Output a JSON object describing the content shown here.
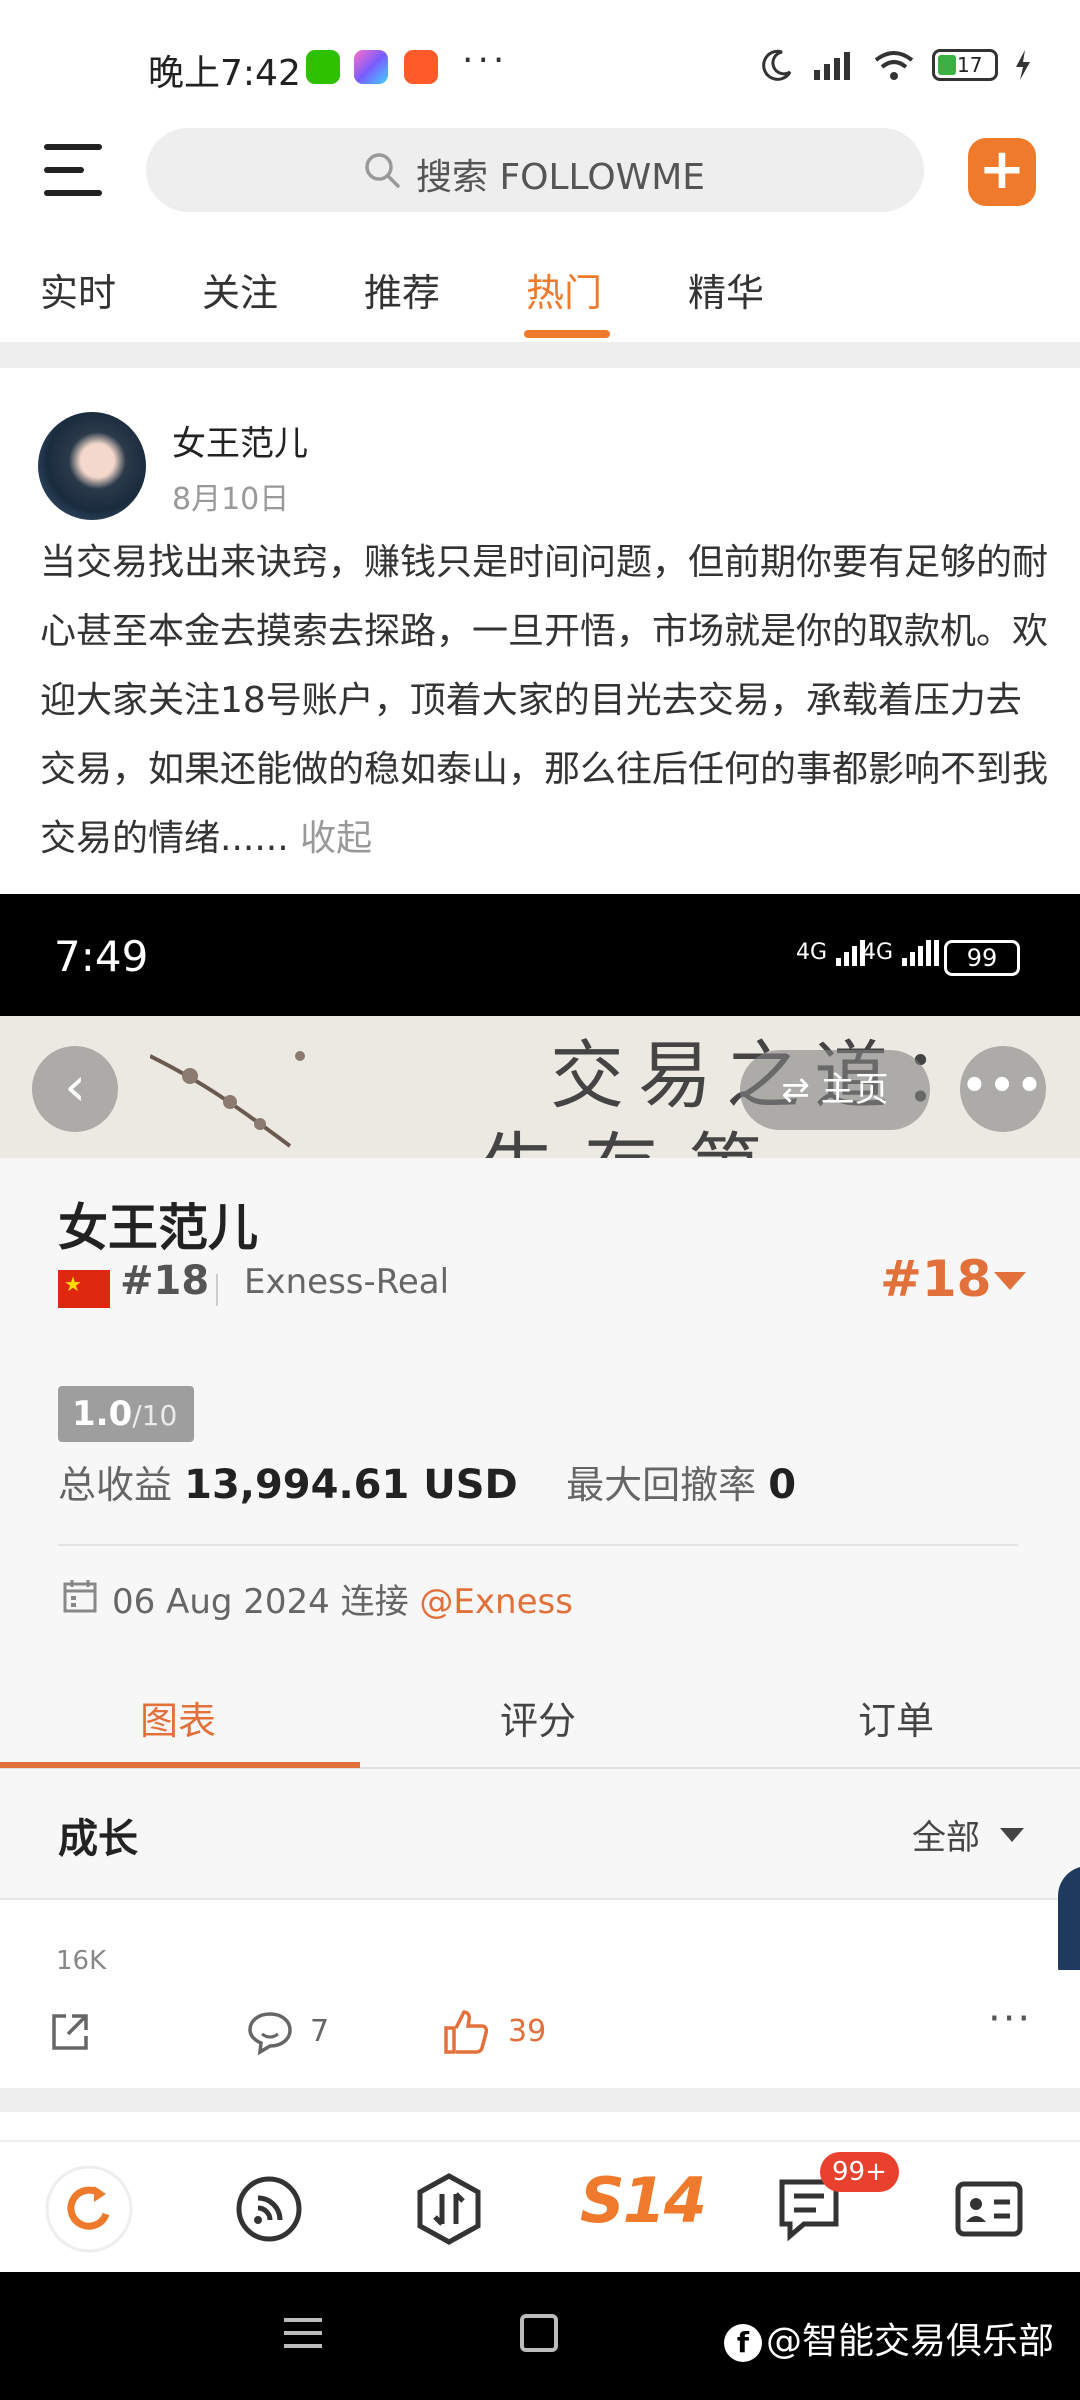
{
  "status_bar": {
    "time": "晚上7:42",
    "dots": "···",
    "battery": "17"
  },
  "header": {
    "search_placeholder": "搜索 FOLLOWME"
  },
  "tabs": [
    {
      "label": "实时"
    },
    {
      "label": "关注"
    },
    {
      "label": "推荐"
    },
    {
      "label": "热门"
    },
    {
      "label": "精华"
    }
  ],
  "active_tab": "热门",
  "post": {
    "author": "女王范儿",
    "date": "8月10日",
    "body": "当交易找出来诀窍，赚钱只是时间问题，但前期你要有足够的耐心甚至本金去摸索去探路，一旦开悟，市场就是你的取款机。欢迎大家关注18号账户，顶着大家的目光去交易，承载着压力去交易，如果还能做的稳如泰山，那么往后任何的事都影响不到我交易的情绪......",
    "collapse_label": "收起"
  },
  "inner": {
    "status": {
      "time": "7:49",
      "signal1": "4G",
      "signal2": "4G",
      "battery": "99"
    },
    "banner": {
      "line1": "交易之道：",
      "line2": "生存第一",
      "home_label": "主页"
    },
    "account": {
      "name": "女王范儿",
      "rank": "#18",
      "server": "Exness-Real",
      "rank_big": "#18",
      "score": "1.0",
      "score_max": "/10",
      "profit_label": "总收益",
      "profit_value": "13,994.61 USD",
      "drawdown_label": "最大回撤率",
      "drawdown_value": "0",
      "connect_date": "06 Aug 2024 连接",
      "connect_broker": "@Exness"
    },
    "tabs": [
      {
        "label": "图表"
      },
      {
        "label": "评分"
      },
      {
        "label": "订单"
      }
    ],
    "growth": {
      "title": "成长",
      "filter": "全部",
      "tick": "16K"
    }
  },
  "actions": {
    "comments": "7",
    "likes": "39"
  },
  "bottom_nav": {
    "center": "S14",
    "badge": "99+"
  },
  "watermark": "@智能交易俱乐部",
  "colors": {
    "accent": "#f07a2b",
    "inner_accent": "#e2703a",
    "badge": "#e8422f"
  }
}
